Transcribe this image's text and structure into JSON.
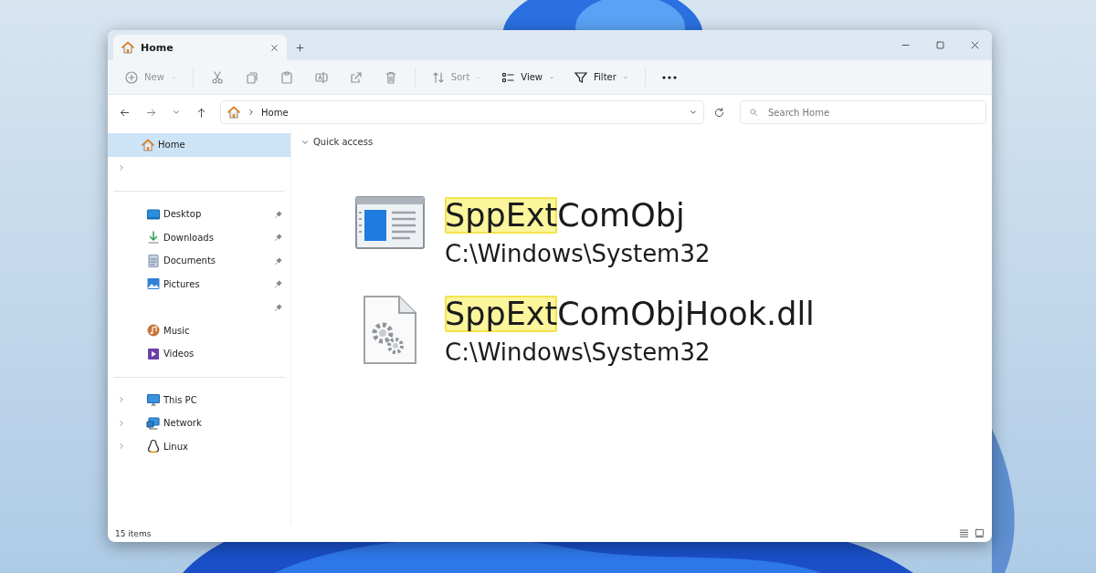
{
  "window": {
    "tabs": [
      {
        "label": "Home",
        "selected": true
      }
    ]
  },
  "toolbar": [
    {
      "kind": "menu",
      "label": "New",
      "disabled": true
    },
    {
      "kind": "separator"
    },
    {
      "kind": "icon",
      "disabled": true
    },
    {
      "kind": "icon",
      "disabled": true
    },
    {
      "kind": "icon",
      "disabled": true
    },
    {
      "kind": "icon",
      "disabled": true
    },
    {
      "kind": "icon",
      "disabled": true
    },
    {
      "kind": "icon",
      "disabled": true
    },
    {
      "kind": "separator"
    },
    {
      "kind": "menu",
      "label": "Sort",
      "disabled": true
    },
    {
      "kind": "menu",
      "label": "View",
      "disabled": false
    },
    {
      "kind": "menu",
      "label": "Filter",
      "disabled": false
    },
    {
      "kind": "separator"
    },
    {
      "kind": "icon",
      "disabled": false
    }
  ],
  "address_bar": {
    "crumbs": [
      "Home"
    ]
  },
  "search": {
    "placeholder": "Search Home"
  },
  "sidebar": {
    "groups": [
      [
        {
          "label": "Home",
          "selected": true,
          "pinned": false,
          "expandable": false
        },
        {
          "selected": false,
          "pinned": false,
          "expandable": true
        }
      ],
      [
        {
          "label": "Desktop",
          "selected": false,
          "pinned": true,
          "expandable": false
        },
        {
          "label": "Downloads",
          "selected": false,
          "pinned": true,
          "expandable": false
        },
        {
          "label": "Documents",
          "selected": false,
          "pinned": true,
          "expandable": false
        },
        {
          "label": "Pictures",
          "selected": false,
          "pinned": true,
          "expandable": false
        },
        {
          "selected": false,
          "pinned": true,
          "expandable": false
        },
        {
          "label": "Music",
          "selected": false,
          "pinned": false,
          "expandable": false
        },
        {
          "label": "Videos",
          "selected": false,
          "pinned": false,
          "expandable": false
        }
      ],
      [
        {
          "label": "This PC",
          "selected": false,
          "pinned": false,
          "expandable": true
        },
        {
          "label": "Network",
          "selected": false,
          "pinned": false,
          "expandable": true
        },
        {
          "label": "Linux",
          "selected": false,
          "pinned": false,
          "expandable": true
        }
      ]
    ]
  },
  "section": {
    "title": "Quick access",
    "expanded": true
  },
  "results": [
    {
      "kind": "app",
      "highlight": "SppExt",
      "rest": "ComObj",
      "path": "C:\\Windows\\System32"
    },
    {
      "kind": "dll",
      "highlight": "SppExt",
      "rest": "ComObjHook.dll",
      "path": "C:\\Windows\\System32"
    }
  ],
  "status_bar": {
    "count": "15 items"
  }
}
